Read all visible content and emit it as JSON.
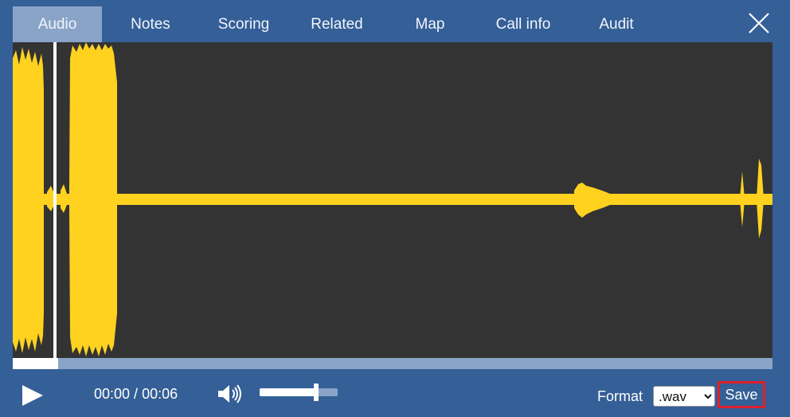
{
  "tabs": [
    {
      "label": "Audio",
      "active": true
    },
    {
      "label": "Notes",
      "active": false
    },
    {
      "label": "Scoring",
      "active": false
    },
    {
      "label": "Related",
      "active": false
    },
    {
      "label": "Map",
      "active": false
    },
    {
      "label": "Call info",
      "active": false
    },
    {
      "label": "Audit",
      "active": false
    }
  ],
  "close_icon": "close-icon",
  "player": {
    "play_icon": "play-icon",
    "current_time": "00:00",
    "separator": " / ",
    "duration": "00:06",
    "volume_icon": "speaker-icon",
    "volume_level": 0.72,
    "progress_fraction": 0.06
  },
  "waveform": {
    "color": "#ffd21f",
    "background": "#333333",
    "playhead_fraction": 0.056
  },
  "format": {
    "label": "Format",
    "selected": ".wav",
    "options": [
      ".wav"
    ]
  },
  "save_label": "Save",
  "colors": {
    "background": "#345f97",
    "tab_active": "#8aa4c8",
    "save_border": "#e0202b"
  }
}
